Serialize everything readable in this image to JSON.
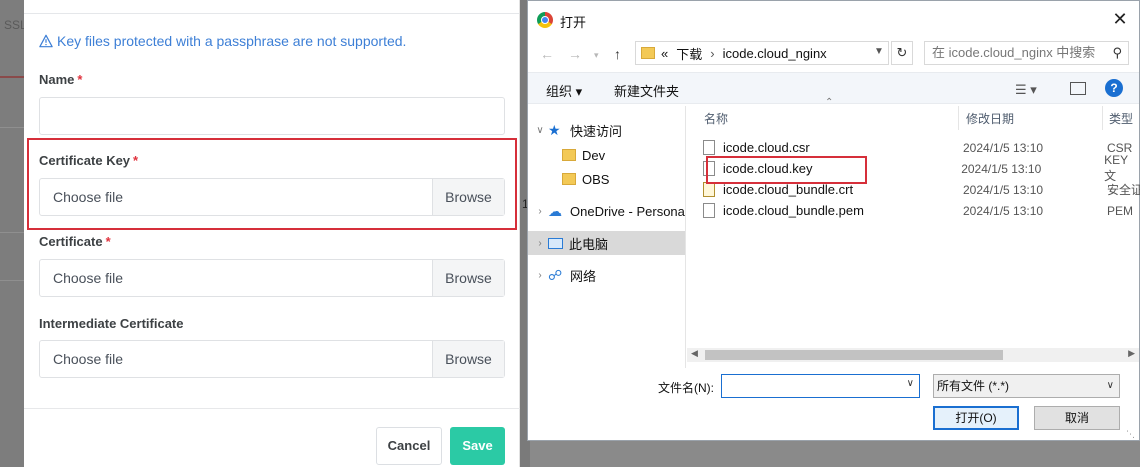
{
  "background": {
    "left_tab_text": "SSL",
    "right_text": "1"
  },
  "form": {
    "warning": "Key files protected with a passphrase are not supported.",
    "name_label": "Name",
    "required_mark": "*",
    "cert_key_label": "Certificate Key",
    "certificate_label": "Certificate",
    "intermediate_label": "Intermediate Certificate",
    "file_placeholder": "Choose file",
    "browse_label": "Browse",
    "cancel_label": "Cancel",
    "save_label": "Save",
    "accent_color": "#2bcaa5",
    "warning_color": "#3d7fd6"
  },
  "dialog": {
    "title": "打开",
    "close": "✕",
    "path": {
      "prefix": "«",
      "parts": [
        "下载",
        "icode.cloud_nginx"
      ]
    },
    "search_placeholder": "在 icode.cloud_nginx 中搜索",
    "toolbar": {
      "organize": "组织 ▾",
      "new_folder": "新建文件夹",
      "help": "?"
    },
    "nav": [
      {
        "label": "快速访问",
        "icon": "star-icon",
        "selected": false
      },
      {
        "label": "Dev",
        "icon": "folder-icon",
        "selected": false
      },
      {
        "label": "OBS",
        "icon": "folder-icon",
        "selected": false
      },
      {
        "label": "OneDrive - Persona",
        "icon": "cloud-icon",
        "selected": false
      },
      {
        "label": "此电脑",
        "icon": "computer-icon",
        "selected": true
      },
      {
        "label": "网络",
        "icon": "network-icon",
        "selected": false
      }
    ],
    "columns": {
      "name": "名称",
      "date": "修改日期",
      "type": "类型"
    },
    "files": [
      {
        "name": "icode.cloud.csr",
        "date": "2024/1/5 13:10",
        "type": "CSR"
      },
      {
        "name": "icode.cloud.key",
        "date": "2024/1/5 13:10",
        "type": "KEY 文"
      },
      {
        "name": "icode.cloud_bundle.crt",
        "date": "2024/1/5 13:10",
        "type": "安全证"
      },
      {
        "name": "icode.cloud_bundle.pem",
        "date": "2024/1/5 13:10",
        "type": "PEM"
      }
    ],
    "filename_label": "文件名(N):",
    "filename_value": "",
    "filetype_value": "所有文件 (*.*)",
    "open_label": "打开(O)",
    "cancel_label": "取消"
  }
}
